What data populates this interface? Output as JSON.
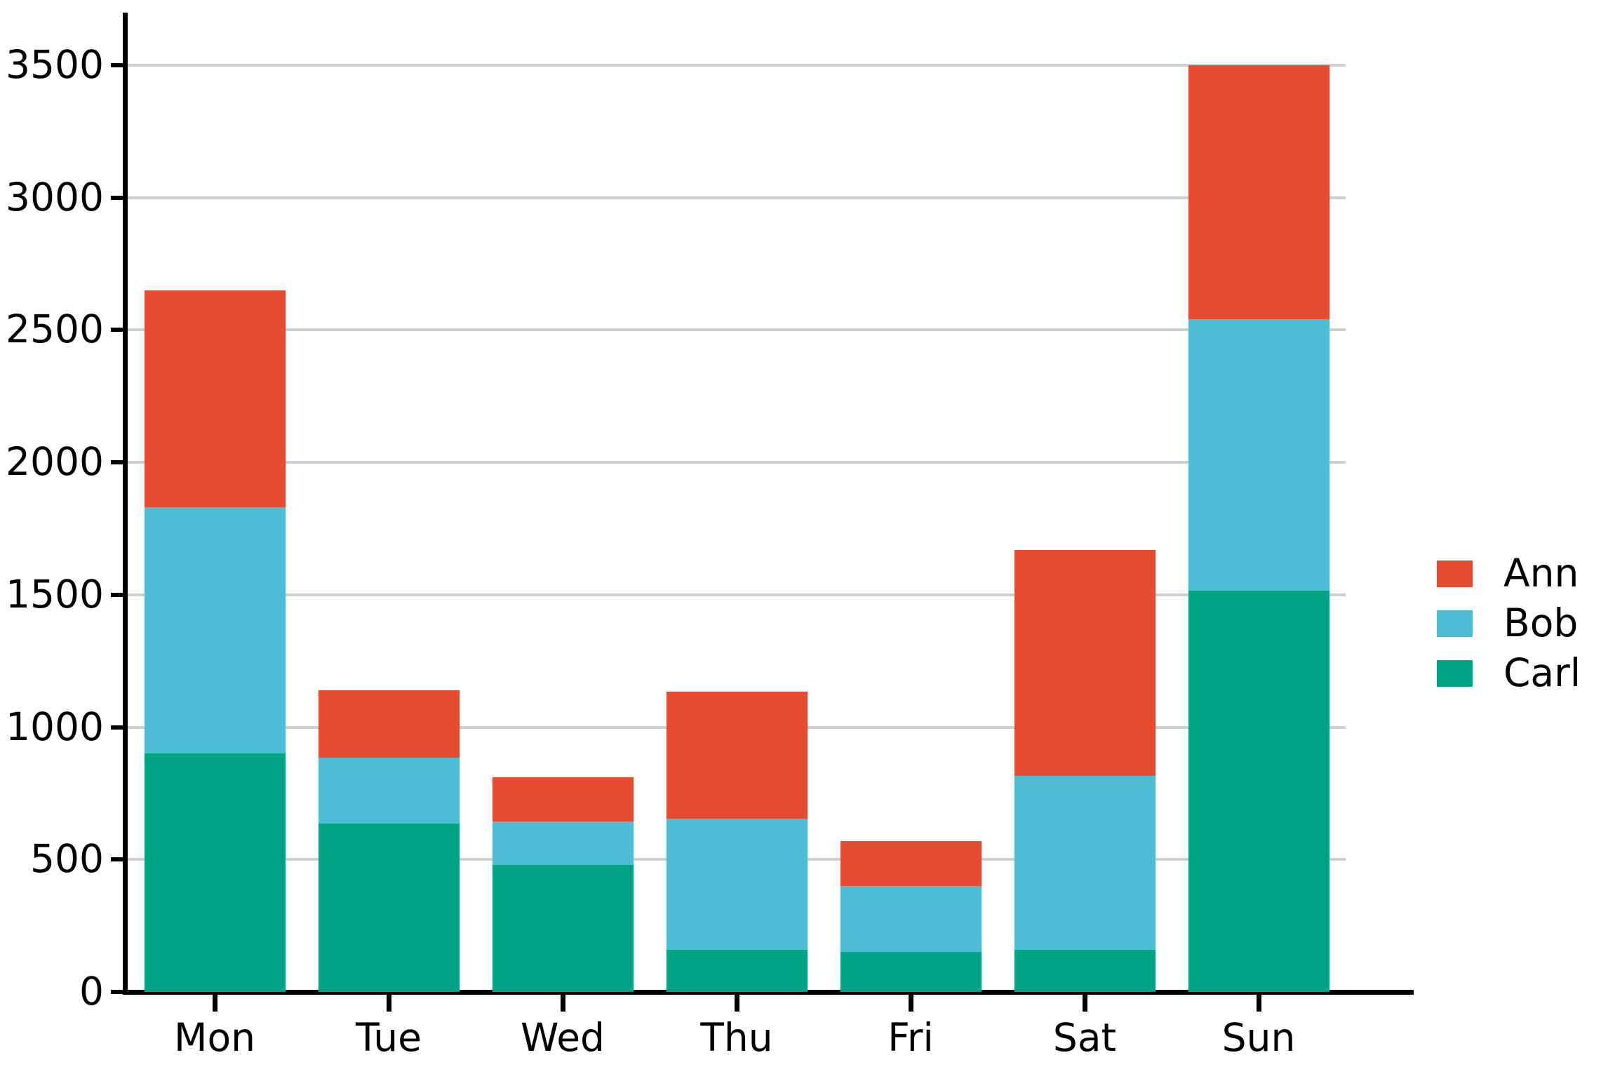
{
  "chart_data": {
    "type": "bar",
    "subtype": "stacked-vertical",
    "title": "",
    "subtitle": "",
    "xlabel": "",
    "ylabel": "",
    "categories": [
      "Mon",
      "Tue",
      "Wed",
      "Thu",
      "Fri",
      "Sat",
      "Sun"
    ],
    "series": [
      {
        "name": "Ann",
        "color": "#e74c33",
        "values": [
          820,
          255,
          165,
          480,
          170,
          855,
          960
        ]
      },
      {
        "name": "Bob",
        "color": "#4ebcd5",
        "values": [
          930,
          250,
          165,
          495,
          250,
          655,
          1025
        ]
      },
      {
        "name": "Carl",
        "color": "#00a383",
        "values": [
          900,
          635,
          480,
          160,
          150,
          160,
          1515
        ]
      }
    ],
    "stack_order_bottom_to_top": [
      "Carl",
      "Bob",
      "Ann"
    ],
    "totals": [
      2650,
      1140,
      810,
      1135,
      570,
      1670,
      3500
    ],
    "ylim": [
      0,
      3660
    ],
    "yticks": [
      0,
      500,
      1000,
      1500,
      2000,
      2500,
      3000,
      3500
    ],
    "ytick_labels": [
      "0",
      "500",
      "1000",
      "1500",
      "2000",
      "2500",
      "3000",
      "3500"
    ],
    "xtick_labels": [
      "Mon",
      "Tue",
      "Wed",
      "Thu",
      "Fri",
      "Sat",
      "Sun"
    ],
    "grid": {
      "horizontal": true,
      "vertical": false,
      "color": "#cfcfcf"
    },
    "legend": {
      "position": "right",
      "entries": [
        {
          "label": "Ann",
          "color": "#e74c33"
        },
        {
          "label": "Bob",
          "color": "#4ebcd5"
        },
        {
          "label": "Carl",
          "color": "#00a383"
        }
      ]
    },
    "axis_color": "#000000",
    "background": "#ffffff"
  }
}
